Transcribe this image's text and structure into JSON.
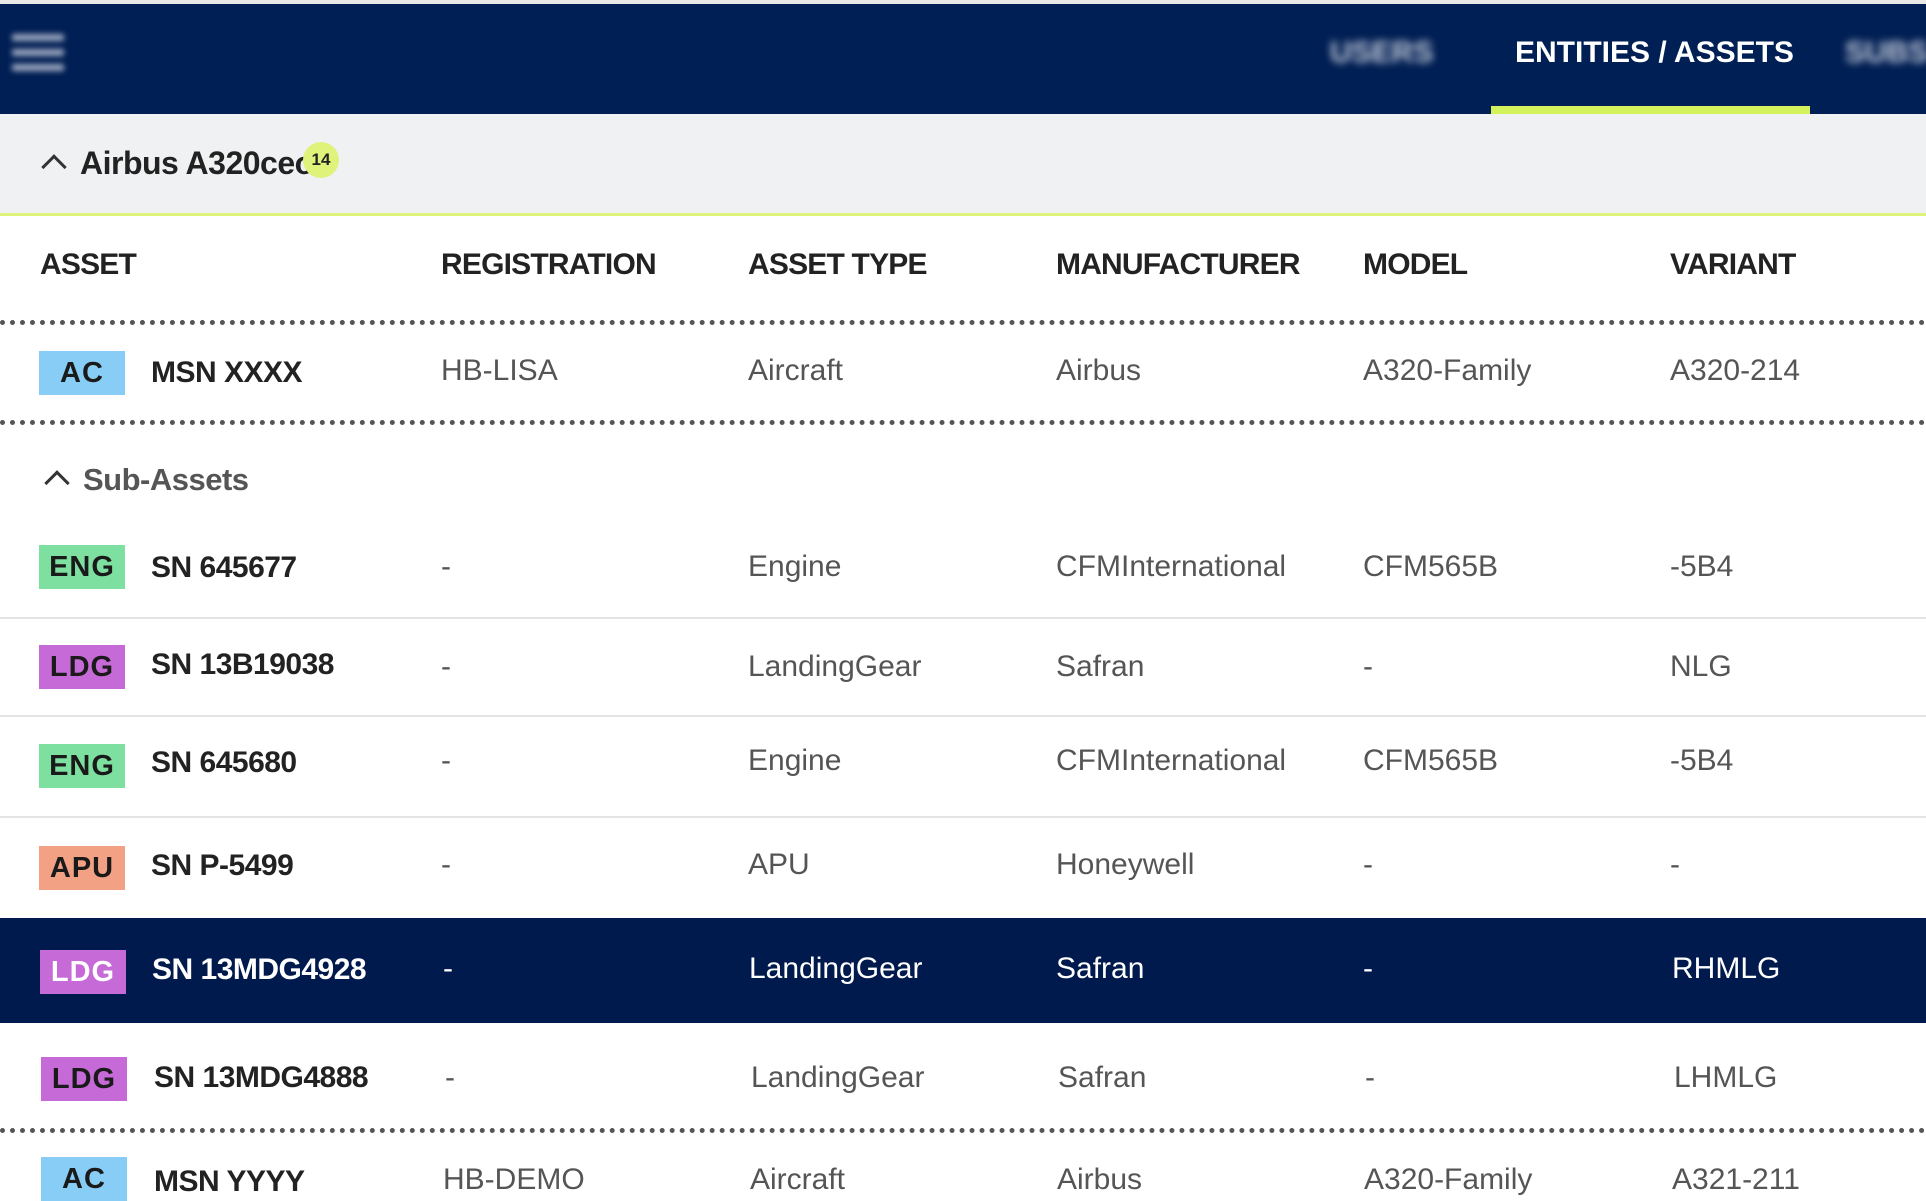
{
  "nav": {
    "tabs": [
      {
        "label": "USERS"
      },
      {
        "label": "ENTITIES / ASSETS"
      },
      {
        "label": "SUBS"
      }
    ]
  },
  "group": {
    "title": "Airbus A320ceo",
    "count": "14"
  },
  "columns": [
    "ASSET",
    "REGISTRATION",
    "ASSET TYPE",
    "MANUFACTURER",
    "MODEL",
    "VARIANT"
  ],
  "main_asset": {
    "badge": "AC",
    "name": "MSN XXXX",
    "registration": "HB-LISA",
    "asset_type": "Aircraft",
    "manufacturer": "Airbus",
    "model": "A320-Family",
    "variant": "A320-214",
    "badge_color": "#87cdf5"
  },
  "sub_assets": {
    "title": "Sub-Assets",
    "rows": [
      {
        "badge": "ENG",
        "name": "SN 645677",
        "registration": "-",
        "asset_type": "Engine",
        "manufacturer": "CFMInternational",
        "model": "CFM565B",
        "variant": "-5B4",
        "badge_color": "#7ee0a0"
      },
      {
        "badge": "LDG",
        "name": "SN 13B19038",
        "registration": "-",
        "asset_type": "LandingGear",
        "manufacturer": "Safran",
        "model": "-",
        "variant": "NLG",
        "badge_color": "#c56ad6"
      },
      {
        "badge": "ENG",
        "name": "SN 645680",
        "registration": "-",
        "asset_type": "Engine",
        "manufacturer": "CFMInternational",
        "model": "CFM565B",
        "variant": "-5B4",
        "badge_color": "#7ee0a0"
      },
      {
        "badge": "APU",
        "name": "SN P-5499",
        "registration": "-",
        "asset_type": "APU",
        "manufacturer": "Honeywell",
        "model": "-",
        "variant": "-",
        "badge_color": "#f2a184"
      },
      {
        "badge": "LDG",
        "name": "SN 13MDG4928",
        "registration": "-",
        "asset_type": "LandingGear",
        "manufacturer": "Safran",
        "model": "-",
        "variant": "RHMLG",
        "badge_color": "#c56ad6",
        "selected": true
      },
      {
        "badge": "LDG",
        "name": "SN 13MDG4888",
        "registration": "-",
        "asset_type": "LandingGear",
        "manufacturer": "Safran",
        "model": "-",
        "variant": "LHMLG",
        "badge_color": "#c56ad6"
      }
    ]
  },
  "next_asset": {
    "badge": "AC",
    "name": "MSN YYYY",
    "registration": "HB-DEMO",
    "asset_type": "Aircraft",
    "manufacturer": "Airbus",
    "model": "A320-Family",
    "variant": "A321-211",
    "badge_color": "#87cdf5"
  },
  "colors": {
    "navy": "#001f54",
    "selected_row": "#001a4d",
    "accent_lime": "#d4f25c"
  }
}
